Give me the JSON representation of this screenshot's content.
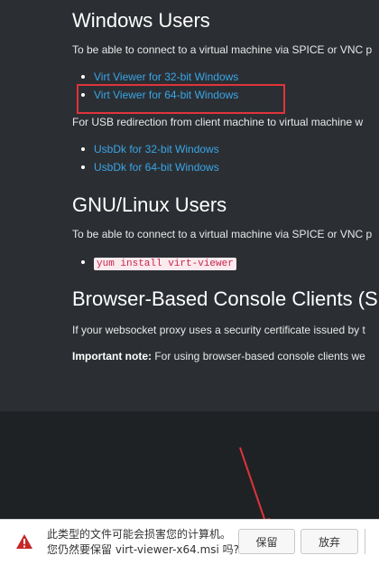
{
  "windows": {
    "heading": "Windows Users",
    "intro": "To be able to connect to a virtual machine via SPICE or VNC p",
    "viewer_links": [
      "Virt Viewer for 32-bit Windows",
      "Virt Viewer for 64-bit Windows"
    ],
    "usb_text": "For USB redirection from client machine to virtual machine w",
    "usb_links": [
      "UsbDk for 32-bit Windows",
      "UsbDk for 64-bit Windows"
    ]
  },
  "linux": {
    "heading": "GNU/Linux Users",
    "intro": "To be able to connect to a virtual machine via SPICE or VNC p",
    "command": "yum install virt-viewer"
  },
  "browser": {
    "heading": "Browser-Based Console Clients (SP",
    "proxy_text": "If your websocket proxy uses a security certificate issued by t",
    "note_label": "Important note:",
    "note_text": " For using browser-based console clients we"
  },
  "download_bar": {
    "line1": "此类型的文件可能会损害您的计算机。",
    "line2": "您仍然要保留 virt-viewer-x64.msi 吗?",
    "keep_label": "保留",
    "discard_label": "放弃"
  },
  "colors": {
    "page_bg": "#2b2f33",
    "link": "#3aa5e6",
    "annotation_red": "#e0333a",
    "warning_red": "#c62828"
  }
}
